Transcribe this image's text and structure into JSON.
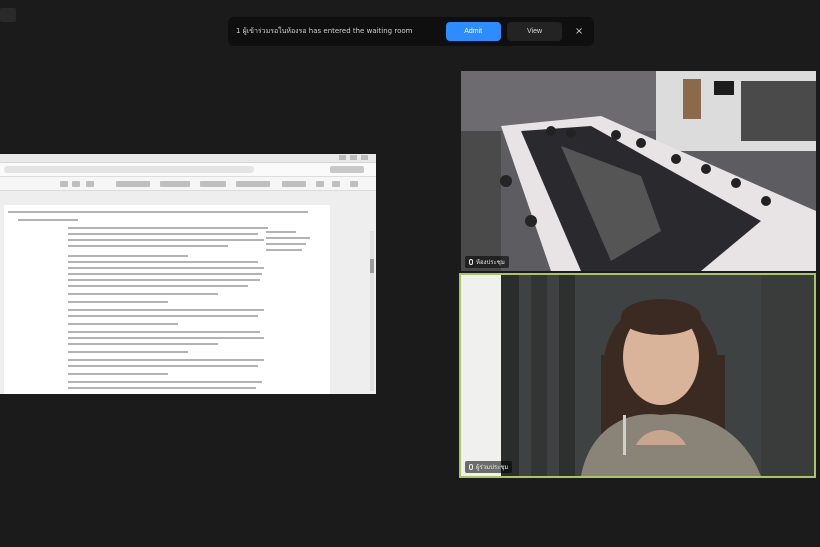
{
  "notification": {
    "message": "1 ผู้เข้าร่วมรอในห้องรอ has entered the waiting room",
    "admit_label": "Admit",
    "view_label": "View",
    "close_glyph": "×"
  },
  "shared_document": {
    "app": "Google Docs"
  },
  "video_tiles": [
    {
      "id": "room",
      "name": "ห้องประชุม",
      "speaking": false
    },
    {
      "id": "speaker",
      "name": "ผู้ร่วมประชุม",
      "speaking": true
    }
  ],
  "colors": {
    "background": "#1b1b1b",
    "admit_button": "#2d8cff",
    "active_speaker_border": "#a9c46a"
  }
}
